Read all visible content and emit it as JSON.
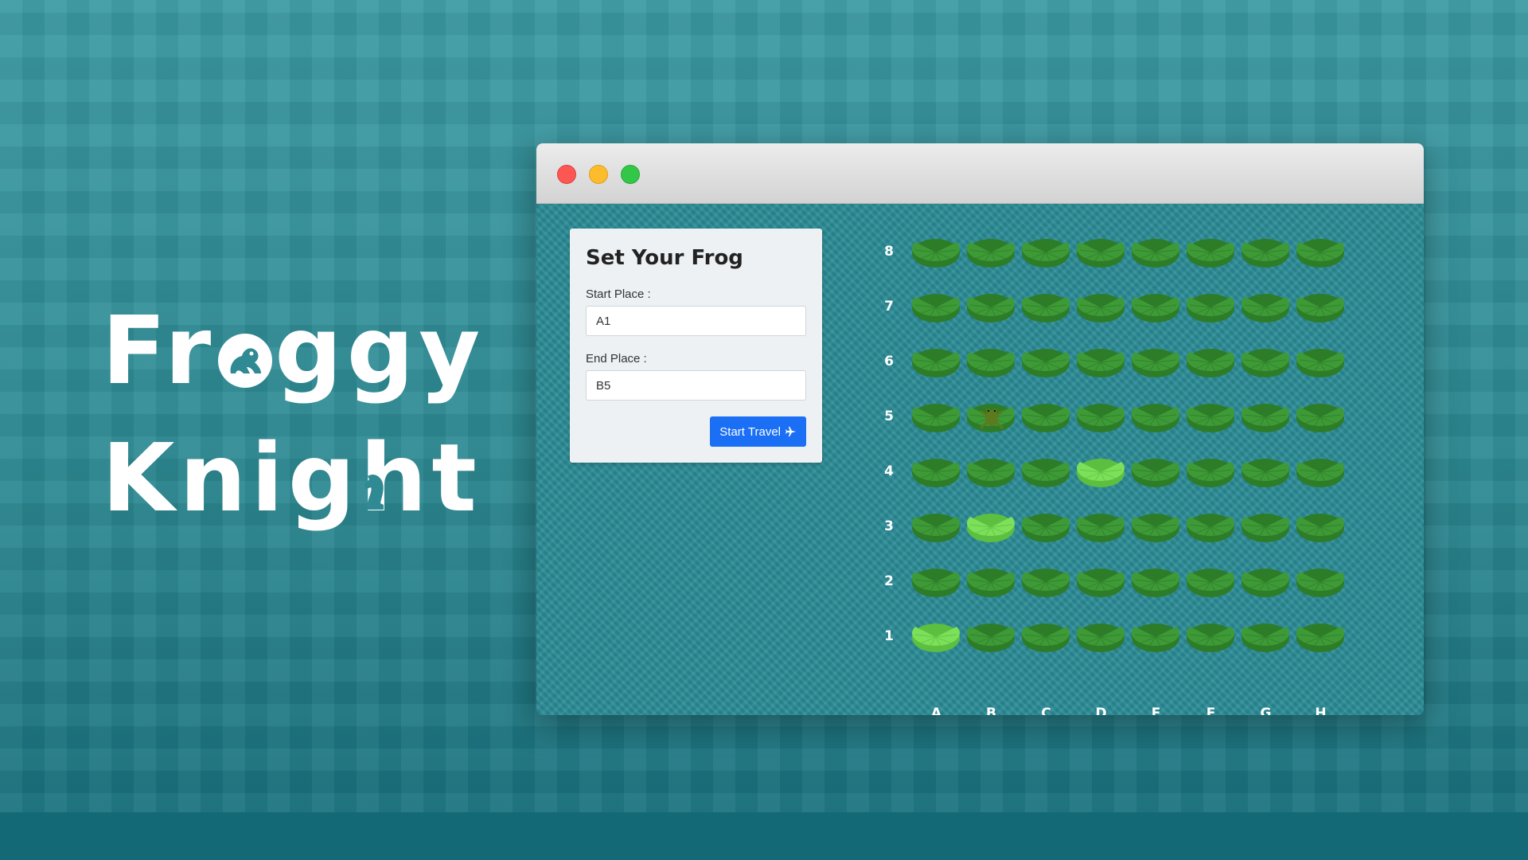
{
  "logo": {
    "line1_part1": "Fr",
    "line1_part2": "ggy",
    "line2_part1": "Knig",
    "line2_part2": "t",
    "icons": [
      "frog-icon",
      "chess-knight-icon"
    ]
  },
  "window": {
    "controls": [
      "close",
      "minimize",
      "zoom"
    ]
  },
  "form": {
    "title": "Set Your Frog",
    "start_label": "Start Place :",
    "start_value": "A1",
    "end_label": "End Place :",
    "end_value": "B5",
    "button_label": "Start Travel",
    "button_icon": "airplane-icon"
  },
  "board": {
    "ranks": [
      "8",
      "7",
      "6",
      "5",
      "4",
      "3",
      "2",
      "1"
    ],
    "files": [
      "A",
      "B",
      "C",
      "D",
      "E",
      "F",
      "G",
      "H"
    ],
    "frog_position": "B5",
    "highlighted": [
      "A1",
      "B3",
      "D4"
    ],
    "colors": {
      "pad": "#3e9a36",
      "pad_dark": "#2d7c28",
      "pad_highlight": "#7de05a",
      "frog": "#5c7a1e"
    }
  }
}
